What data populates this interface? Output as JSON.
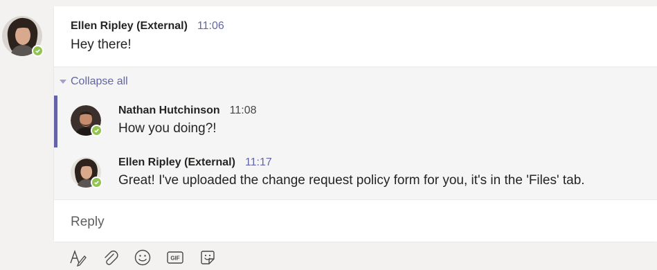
{
  "root_message": {
    "sender": "Ellen Ripley (External)",
    "time": "11:06",
    "text": "Hey there!"
  },
  "thread": {
    "collapse_label": "Collapse all",
    "replies": [
      {
        "sender": "Nathan Hutchinson",
        "time": "11:08",
        "text": "How you doing?!"
      },
      {
        "sender": "Ellen Ripley (External)",
        "time": "11:17",
        "text": "Great! I've uploaded the change request policy form for you, it's in the 'Files' tab."
      }
    ]
  },
  "reply": {
    "placeholder": "Reply"
  },
  "toolbar": {
    "icons": [
      "format-icon",
      "attach-icon",
      "emoji-icon",
      "gif-icon",
      "sticker-icon"
    ],
    "gif_text": "GIF"
  },
  "colors": {
    "accent": "#6264a7",
    "presence": "#92c353",
    "background": "#f3f2f1"
  }
}
